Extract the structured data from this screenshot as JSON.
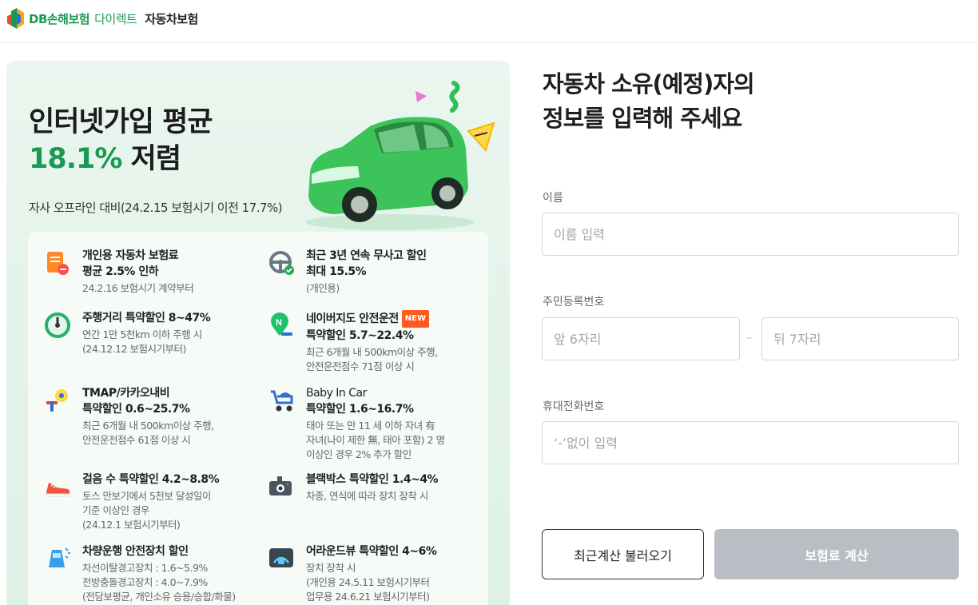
{
  "header": {
    "brand_db": "DB손해보험",
    "brand_direct": "다이렉트",
    "product": "자동차보험"
  },
  "promo": {
    "title_line1": "인터넷가입 평균",
    "title_highlight": "18.1%",
    "title_suffix": " 저렴",
    "note": "자사 오프라인 대비(24.2.15 보험시기 이전 17.7%)",
    "benefits": [
      {
        "icon": "document-discount-icon",
        "title": "개인용 자동차 보험료",
        "title2": "평균 2.5% 인하",
        "desc": "24.2.16 보험시기 계약부터",
        "desc2": ""
      },
      {
        "icon": "steering-wheel-icon",
        "title": "최근 3년 연속 무사고 할인",
        "title2": "최대 15.5%",
        "desc": "(개인용)",
        "desc2": ""
      },
      {
        "icon": "speedometer-icon",
        "title": "주행거리 특약할인 8~47%",
        "title2": "",
        "desc": "연간 1만 5천km 이하 주행 시",
        "desc2": "(24.12.12 보험시기부터)"
      },
      {
        "icon": "naver-map-pin-icon",
        "title": "네이버지도 안전운전",
        "badge": "NEW",
        "title2": "특약할인 5.7~22.4%",
        "desc": "최근 6개월 내 500km이상 주행,",
        "desc2": "안전운전점수 71점 이상 시"
      },
      {
        "icon": "tmap-kakao-icon",
        "title": "TMAP/카카오내비",
        "title2": "특약할인 0.6~25.7%",
        "desc": "최근 6개월 내 500km이상 주행,",
        "desc2": "안전운전점수 61점 이상 시"
      },
      {
        "icon": "baby-stroller-icon",
        "title": "Baby In Car",
        "title2": "특약할인 1.6~16.7%",
        "desc": "태아 또는 만 11 세 이하 자녀 有",
        "desc2": "자녀(나이 제한 無, 태아 포함) 2 명",
        "desc3": "이상인 경우 2% 추가 할인"
      },
      {
        "icon": "sneaker-icon",
        "title": "걸음 수 특약할인 4.2~8.8%",
        "title2": "",
        "desc": "토스 만보기에서 5천보 달성일이",
        "desc2": "기준 이상인 경우",
        "desc3": "(24.12.1 보험시기부터)"
      },
      {
        "icon": "dashcam-icon",
        "title": "블랙박스 특약할인 1.4~4%",
        "title2": "",
        "desc": "차종, 연식에 따라 장치 장착 시",
        "desc2": ""
      },
      {
        "icon": "car-safety-icon",
        "title": "차량운행 안전장치 할인",
        "title2": "",
        "desc": "차선이탈경고장치 : 1.6~5.9%",
        "desc2": "전방충돌경고장치 : 4.0~7.9%",
        "desc3": "(전담보평균, 개인소유 승용/승합/화물)"
      },
      {
        "icon": "around-view-icon",
        "title": "어라운드뷰 특약할인 4~6%",
        "title2": "",
        "desc": "장치 장착 시",
        "desc2": "(개인용 24.5.11 보험시기부터",
        "desc3": "업무용 24.6.21 보험시기부터)"
      }
    ]
  },
  "form": {
    "title_line1": "자동차 소유(예정)자의",
    "title_line2": "정보를 입력해 주세요",
    "name_label": "이름",
    "name_placeholder": "이름 입력",
    "rrn_label": "주민등록번호",
    "rrn_front_placeholder": "앞 6자리",
    "rrn_dash": "–",
    "rrn_back_placeholder": "뒤 7자리",
    "phone_label": "휴대전화번호",
    "phone_placeholder": "‘-’없이 입력",
    "recent_button": "최근계산 불러오기",
    "calc_button": "보험료 계산"
  },
  "colors": {
    "brand_green": "#1a9a50",
    "promo_bg": "#e6f5ec",
    "new_badge": "#ff5a1f",
    "calc_button_disabled": "#b9bdc4"
  }
}
